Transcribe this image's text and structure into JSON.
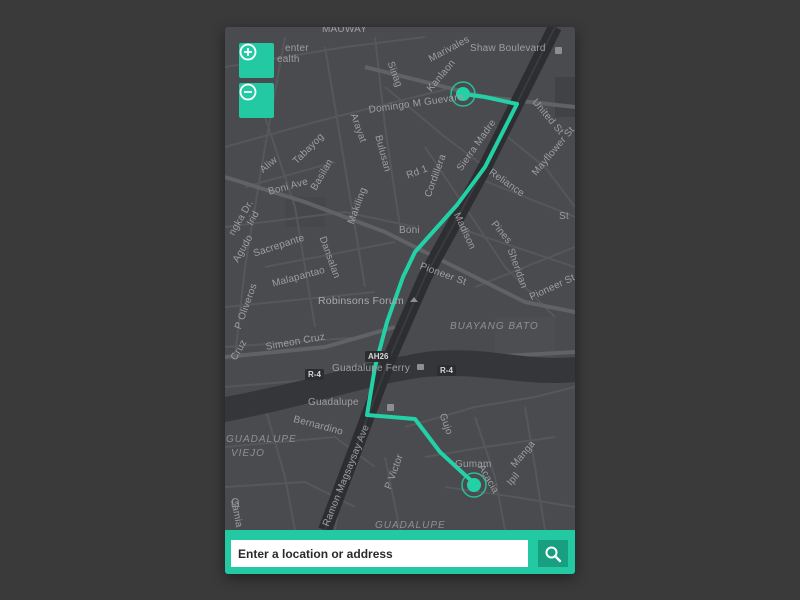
{
  "colors": {
    "accent": "#23c9a3",
    "accent_dark": "#179f80",
    "map_background": "#4a4b4e",
    "road": "#5d5f63",
    "highway": "#2f3033",
    "river": "#333437",
    "route": "#23d1a6",
    "page_background": "#3a3a3a"
  },
  "controls": {
    "zoom_in_icon": "plus-circle-icon",
    "zoom_out_icon": "minus-circle-icon",
    "search_icon": "magnifier-icon"
  },
  "search": {
    "placeholder": "Enter a location or address"
  },
  "route": {
    "start_marker": "route-start-marker",
    "end_marker": "route-end-marker"
  },
  "map": {
    "streets": {
      "mauway": "MAUWAY",
      "center_health": "enter",
      "health": "ealth",
      "marivales": "Marivales",
      "sinag": "Sinag",
      "kanlaon": "Kanlaon",
      "domingo": "Domingo M Guevara",
      "shaw": "Shaw Boulevard",
      "united": "United St",
      "aliw": "Aliw",
      "tabayog": "Tabayog",
      "arayat": "Arayat",
      "bulusan": "Bulusan",
      "basilan": "Basilan",
      "rd1": "Rd 1",
      "cordillera": "Cordillera",
      "sierra": "Sierra Madre",
      "mayflower": "Mayflower St",
      "reliance": "Reliance",
      "boni_ave": "Boni Ave",
      "makiling": "Makiling",
      "boni": "Boni",
      "madison": "Madison",
      "pines": "Pines",
      "sheridan": "Sheridan",
      "sacrepante": "Sacrepante",
      "irid": "Irid",
      "agudo": "Agudo",
      "ngka": "ngka Dr.",
      "dansalan": "Dansalan",
      "malapantao": "Malapantao",
      "pioneer_st": "Pioneer St",
      "pioneer_st2": "Pioneer St",
      "p_oliveros": "P Oliveros",
      "cruz": "Cruz",
      "simeon": "Simeon Cruz",
      "guadalupe_ferry": "Guadalupe Ferry",
      "guadalupe": "Guadalupe",
      "bernardino": "Bernardino",
      "gujo": "Gujo",
      "manga": "Manga",
      "acacia": "Acacia",
      "ipil": "Ipil",
      "cami": "Camia",
      "victor": "P Victor",
      "magsaysay": "Ramon Magsaysay Ave",
      "gumamela": "Gumam",
      "ta": "ta",
      "st": "St"
    },
    "districts": {
      "buayang_bato": "BUAYANG BATO",
      "guadalupe": "GUADALUPE",
      "viejo": "VIEJO",
      "guadalupe_bottom": "GUADALUPE"
    },
    "pois": {
      "robinsons": "Robinsons Forum"
    },
    "shields": {
      "ah26": "AH26",
      "r4_left": "R-4",
      "r4_right": "R-4"
    }
  }
}
